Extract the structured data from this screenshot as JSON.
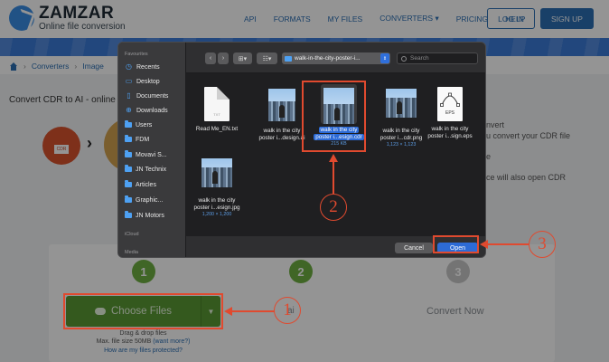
{
  "site": {
    "logo_name": "ZAMZAR",
    "logo_tagline": "Online file conversion",
    "nav": [
      "API",
      "FORMATS",
      "MY FILES",
      "CONVERTERS ▾",
      "PRICING",
      "HELP"
    ],
    "login": "LOG IN",
    "signup": "SIGN UP",
    "breadcrumb": [
      "Converters",
      "Image"
    ],
    "page_title": "Convert CDR to AI - online a",
    "cdr_badge": "CDR",
    "side_text": [
      "nvert",
      "u convert your CDR file",
      "e",
      "ce will also open CDR"
    ],
    "steps": [
      "1",
      "2",
      "3"
    ],
    "choose_files": "Choose Files",
    "drag_drop": "Drag & drop files",
    "max_size": "Max. file size 50MB",
    "want_more": "(want more?)",
    "protected": "How are my files protected?",
    "step2_label": "ai",
    "convert_now": "Convert Now"
  },
  "dialog": {
    "sidebar": {
      "favourites_heading": "Favourites",
      "items": [
        {
          "label": "Recents",
          "icon": "clock-icon"
        },
        {
          "label": "Desktop",
          "icon": "desktop-icon"
        },
        {
          "label": "Documents",
          "icon": "document-icon"
        },
        {
          "label": "Downloads",
          "icon": "download-icon"
        },
        {
          "label": "Users",
          "icon": "users-icon"
        },
        {
          "label": "FDM",
          "icon": "folder-icon"
        },
        {
          "label": "Movavi S...",
          "icon": "folder-icon"
        },
        {
          "label": "JN Technix",
          "icon": "folder-icon"
        },
        {
          "label": "Articles",
          "icon": "folder-icon"
        },
        {
          "label": "Graphic...",
          "icon": "folder-icon"
        },
        {
          "label": "JN Motors",
          "icon": "folder-icon"
        }
      ],
      "icloud_heading": "iCloud",
      "media_heading": "Media"
    },
    "toolbar": {
      "back": "‹",
      "forward": "›",
      "location": "walk-in-the-city-poster-i...",
      "search_placeholder": "Search"
    },
    "files": [
      {
        "name_line1": "Read Me_EN.txt",
        "name_line2": "",
        "meta": "",
        "kind": "txt",
        "txt_label": "TXT"
      },
      {
        "name_line1": "walk in the city",
        "name_line2": "poster i...design.ai",
        "meta": "",
        "kind": "poster"
      },
      {
        "name_line1": "walk in the city",
        "name_line2": "poster i...esign.cdr",
        "meta": "215 KB",
        "kind": "poster",
        "selected": true
      },
      {
        "name_line1": "walk in the city",
        "name_line2": "poster i...cdr.png",
        "meta": "1,123 × 1,123",
        "kind": "poster"
      },
      {
        "name_line1": "walk in the city",
        "name_line2": "poster i...sign.eps",
        "meta": "",
        "kind": "eps",
        "eps_label": "EPS"
      },
      {
        "name_line1": "walk in the city",
        "name_line2": "poster i...esign.jpg",
        "meta": "1,200 × 1,200",
        "kind": "poster"
      }
    ],
    "cancel": "Cancel",
    "open": "Open"
  },
  "annotations": [
    "1",
    "2",
    "3"
  ],
  "colors": {
    "annotation": "#e04a2f",
    "accent_blue": "#2d6bd6",
    "zamzar_green": "#5a9a35",
    "zamzar_blue": "#2c6fb3"
  }
}
